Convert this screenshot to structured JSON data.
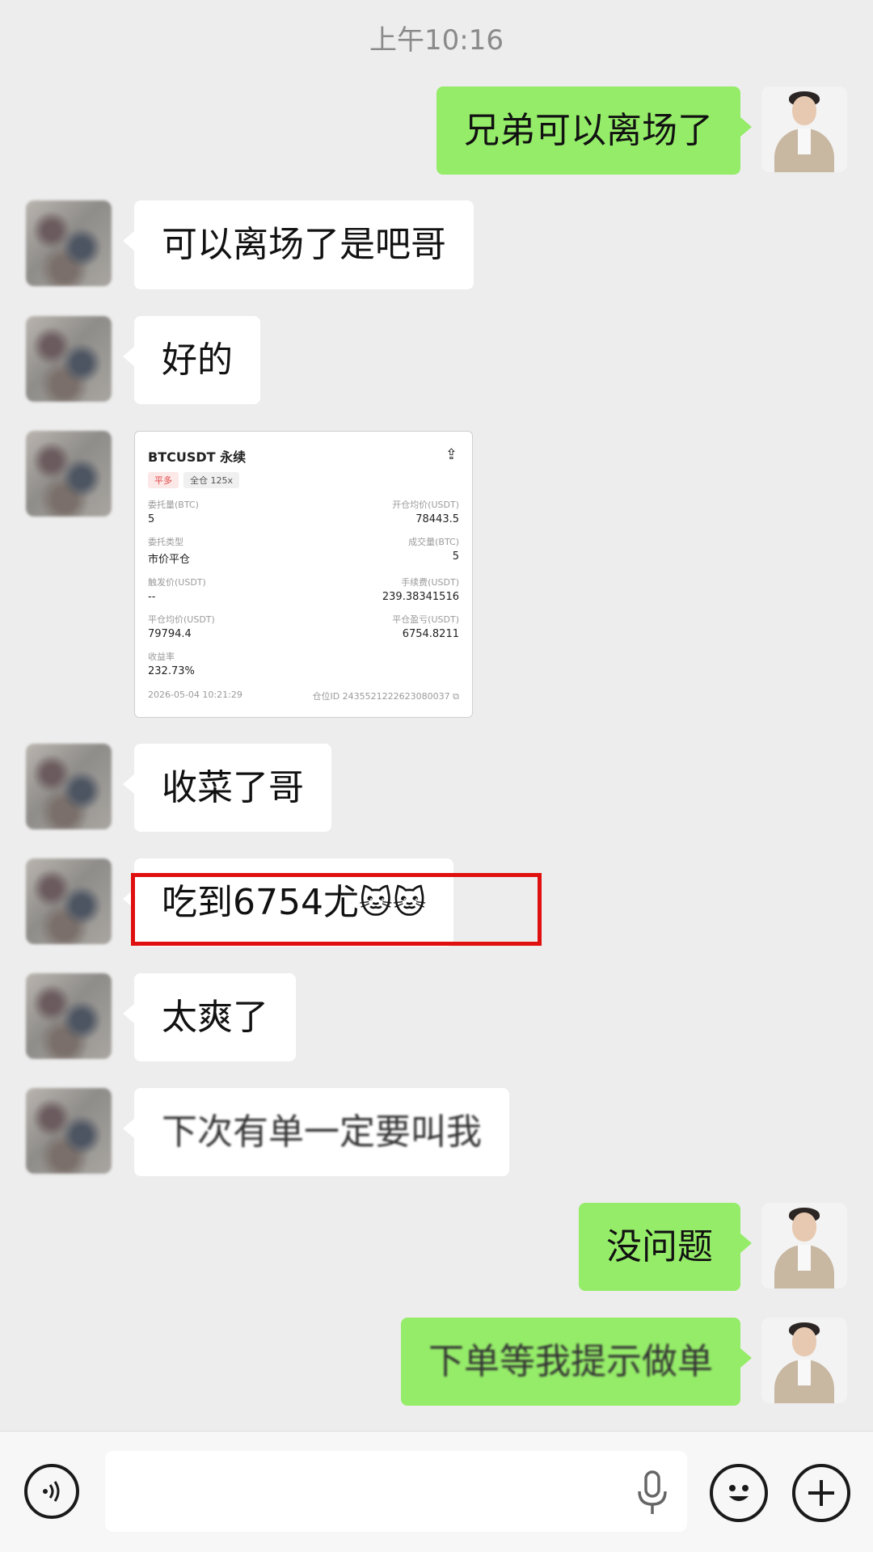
{
  "status": {
    "time": "上午10:16"
  },
  "messages": [
    {
      "side": "right",
      "text": "兄弟可以离场了"
    },
    {
      "side": "left",
      "text": "可以离场了是吧哥"
    },
    {
      "side": "left",
      "text": "好的"
    },
    {
      "side": "left",
      "type": "image-card"
    },
    {
      "side": "left",
      "text": "收菜了哥"
    },
    {
      "side": "left",
      "text": "吃到6754尤",
      "emoji": "🐱🐱"
    },
    {
      "side": "left",
      "text": "太爽了"
    },
    {
      "side": "left",
      "text": "下次有单一定要叫我"
    },
    {
      "side": "right",
      "text": "没问题"
    },
    {
      "side": "right",
      "text": "下单等我提示做单"
    }
  ],
  "order_card": {
    "title": "BTCUSDT 永续",
    "tag1": "平多",
    "tag2": "全仓 125x",
    "qty_label": "委托量(BTC)",
    "qty_value": "5",
    "open_avg_label": "开仓均价(USDT)",
    "open_avg_value": "78443.5",
    "type_label": "委托类型",
    "type_value": "市价平仓",
    "filled_label": "成交量(BTC)",
    "filled_value": "5",
    "trigger_label": "触发价(USDT)",
    "trigger_value": "--",
    "fee_label": "手续费(USDT)",
    "fee_value": "239.38341516",
    "close_avg_label": "平仓均价(USDT)",
    "close_avg_value": "79794.4",
    "pnl_label": "平仓盈亏(USDT)",
    "pnl_value": "6754.8211",
    "roi_label": "收益率",
    "roi_value": "232.73%",
    "datetime": "2026-05-04 10:21:29",
    "position_id": "仓位ID 2435521222623080037"
  },
  "colors": {
    "bubble_right": "#95ec69",
    "bubble_left": "#ffffff",
    "highlight": "#e01010",
    "bg": "#ededed"
  },
  "icons": [
    "voice-icon",
    "microphone-icon",
    "emoji-icon",
    "plus-icon",
    "share-icon",
    "copy-icon"
  ]
}
